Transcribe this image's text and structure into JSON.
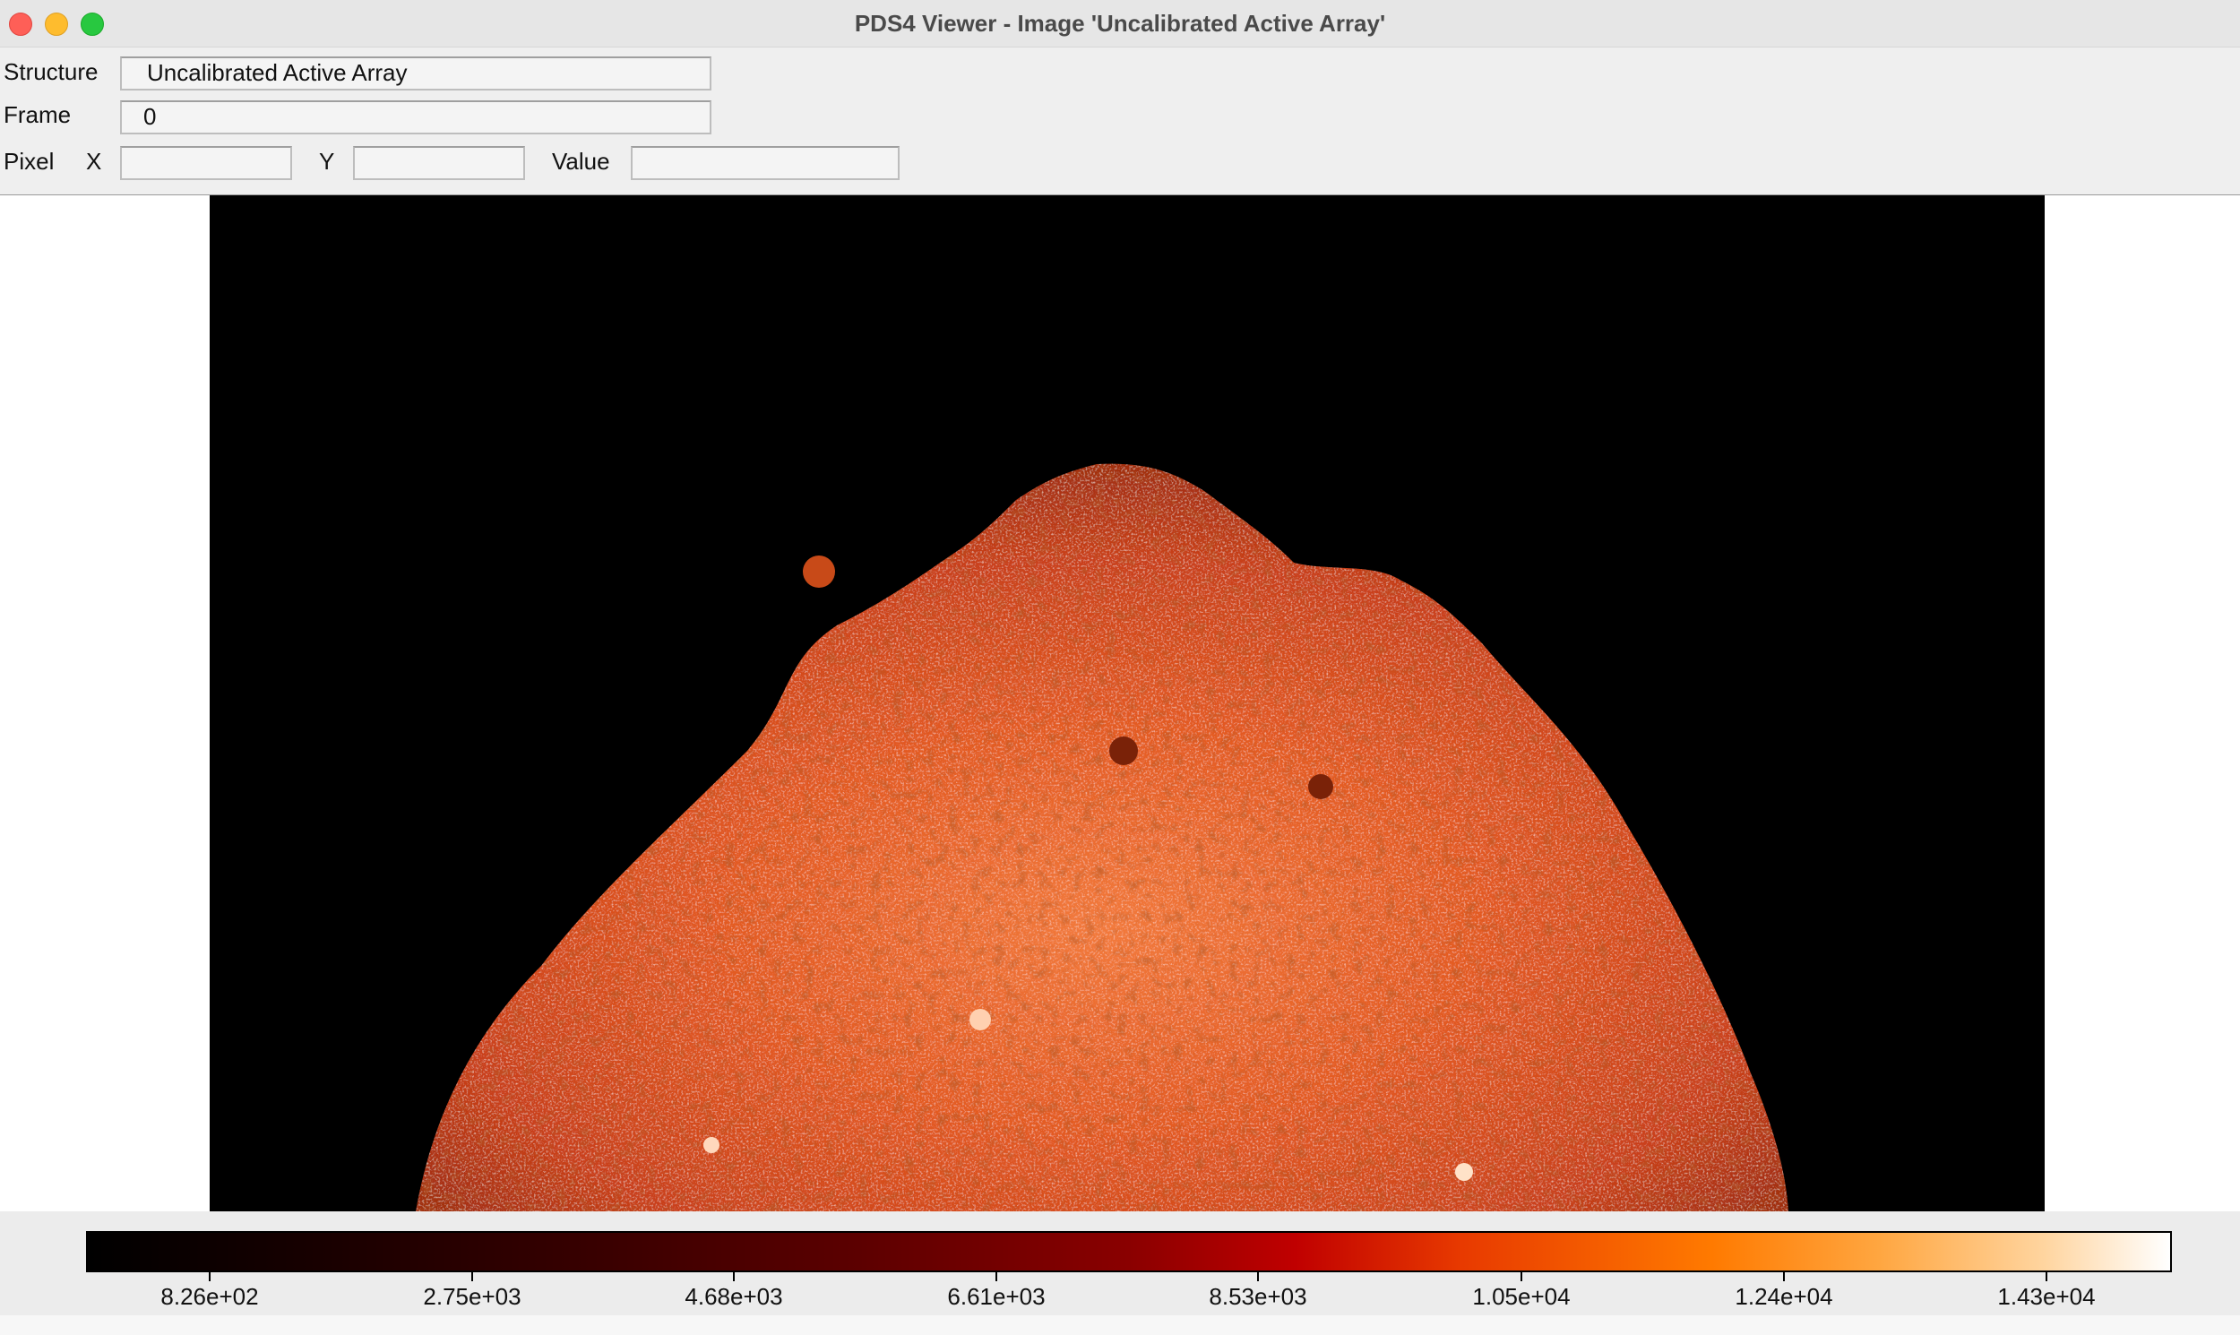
{
  "window": {
    "title": "PDS4 Viewer - Image 'Uncalibrated Active Array'"
  },
  "controls": {
    "structure_label": "Structure",
    "structure_value": "Uncalibrated Active Array",
    "frame_label": "Frame",
    "frame_value": "0",
    "pixel_label": "Pixel",
    "x_label": "X",
    "x_value": "",
    "y_label": "Y",
    "y_value": "",
    "value_label": "Value",
    "value_value": ""
  },
  "colorbar": {
    "colormap": [
      "#000000",
      "#5c0000",
      "#c00000",
      "#ff7a00",
      "#ffffff"
    ],
    "ticks": [
      "8.26e+02",
      "2.75e+03",
      "4.68e+03",
      "6.61e+03",
      "8.53e+03",
      "1.05e+04",
      "1.24e+04",
      "1.43e+04"
    ]
  }
}
